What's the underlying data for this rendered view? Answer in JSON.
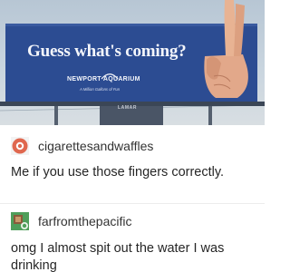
{
  "photo": {
    "billboard_headline": "Guess what's coming?",
    "billboard_logo": "NEWPORT AQUARIUM",
    "billboard_tagline": "A Million Gallons of Fun",
    "billboard_operator": "LAMAR",
    "colors": {
      "billboard_blue": "#2c4c92",
      "sky": "#c3cfda"
    },
    "icon": "peace-sign-hand"
  },
  "posts": [
    {
      "username": "cigarettesandwaffles",
      "text": "Me if you use those fingers correctly.",
      "avatar_icon": "red-circle-avatar"
    },
    {
      "username": "farfromthepacific",
      "text": "omg I almost spit out the water I was drinking",
      "avatar_icon": "green-box-avatar"
    }
  ]
}
